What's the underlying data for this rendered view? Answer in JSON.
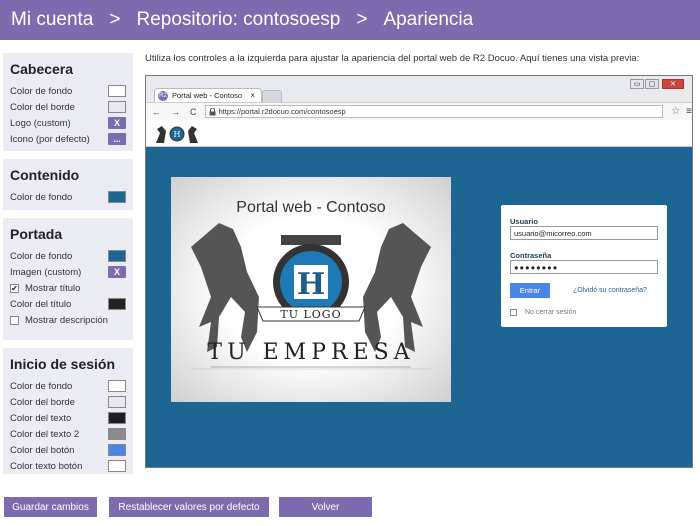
{
  "header": {
    "crumb1": "Mi cuenta",
    "sep1": ">",
    "crumb2": "Repositorio: contosoesp",
    "sep2": ">",
    "crumb3": "Apariencia"
  },
  "intro": "Utiliza los controles a la izquierda para ajustar la apariencia del portal web de R2 Docuo. Aquí tienes una vista previa:",
  "panels": {
    "cabecera": {
      "title": "Cabecera",
      "bg_label": "Color de fondo",
      "border_label": "Color del borde",
      "logo_label": "Logo (custom)",
      "icon_label": "Icono (por defecto)",
      "x_glyph": "X",
      "dots_glyph": "...",
      "bg_color": "#ffffff",
      "border_color": "#e8e8e8"
    },
    "contenido": {
      "title": "Contenido",
      "bg_label": "Color de fondo",
      "bg_color": "#1d6592"
    },
    "portada": {
      "title": "Portada",
      "bg_label": "Color de fondo",
      "image_label": "Imagen (custom)",
      "show_title_label": "Mostrar título",
      "title_color_label": "Color del título",
      "show_desc_label": "Mostrar descripción",
      "x_glyph": "X",
      "check_glyph": "✔",
      "bg_color": "#1d6592",
      "title_color": "#222222"
    },
    "login": {
      "title": "Inicio de sesión",
      "items": [
        {
          "label": "Color de fondo",
          "color": "#ffffff"
        },
        {
          "label": "Color del borde",
          "color": "#e8e8e8"
        },
        {
          "label": "Color del texto",
          "color": "#1e1e1e"
        },
        {
          "label": "Color del texto 2",
          "color": "#8a8a8a"
        },
        {
          "label": "Color del botón",
          "color": "#4a86e8"
        },
        {
          "label": "Color texto botón",
          "color": "#ffffff"
        }
      ]
    }
  },
  "preview": {
    "tab_title": "Portal web - Contoso",
    "tab_close": "×",
    "tab_icon": "R2",
    "url": "https://portal.r2docuo.com/contosoesp",
    "win_min": "▭",
    "win_max": "▢",
    "win_close": "✕",
    "nav_back": "←",
    "nav_fwd": "→",
    "nav_reload": "C",
    "star_icon": "☆",
    "menu_icon": "≡",
    "hero_title": "Portal web - Contoso",
    "logo_letter": "H",
    "logo_text": "TU LOGO",
    "company": "TU EMPRESA",
    "login": {
      "user_label": "Usuario",
      "user_value": "usuario@micorreo.com",
      "pass_label": "Contraseña",
      "pass_value": "●●●●●●●●",
      "submit": "Entrar",
      "forgot": "¿Olvidó su contraseña?",
      "keep": "No cerrar sesión"
    }
  },
  "actions": {
    "save": "Guardar cambios",
    "reset": "Restablecer valores por defecto",
    "back": "Volver"
  }
}
